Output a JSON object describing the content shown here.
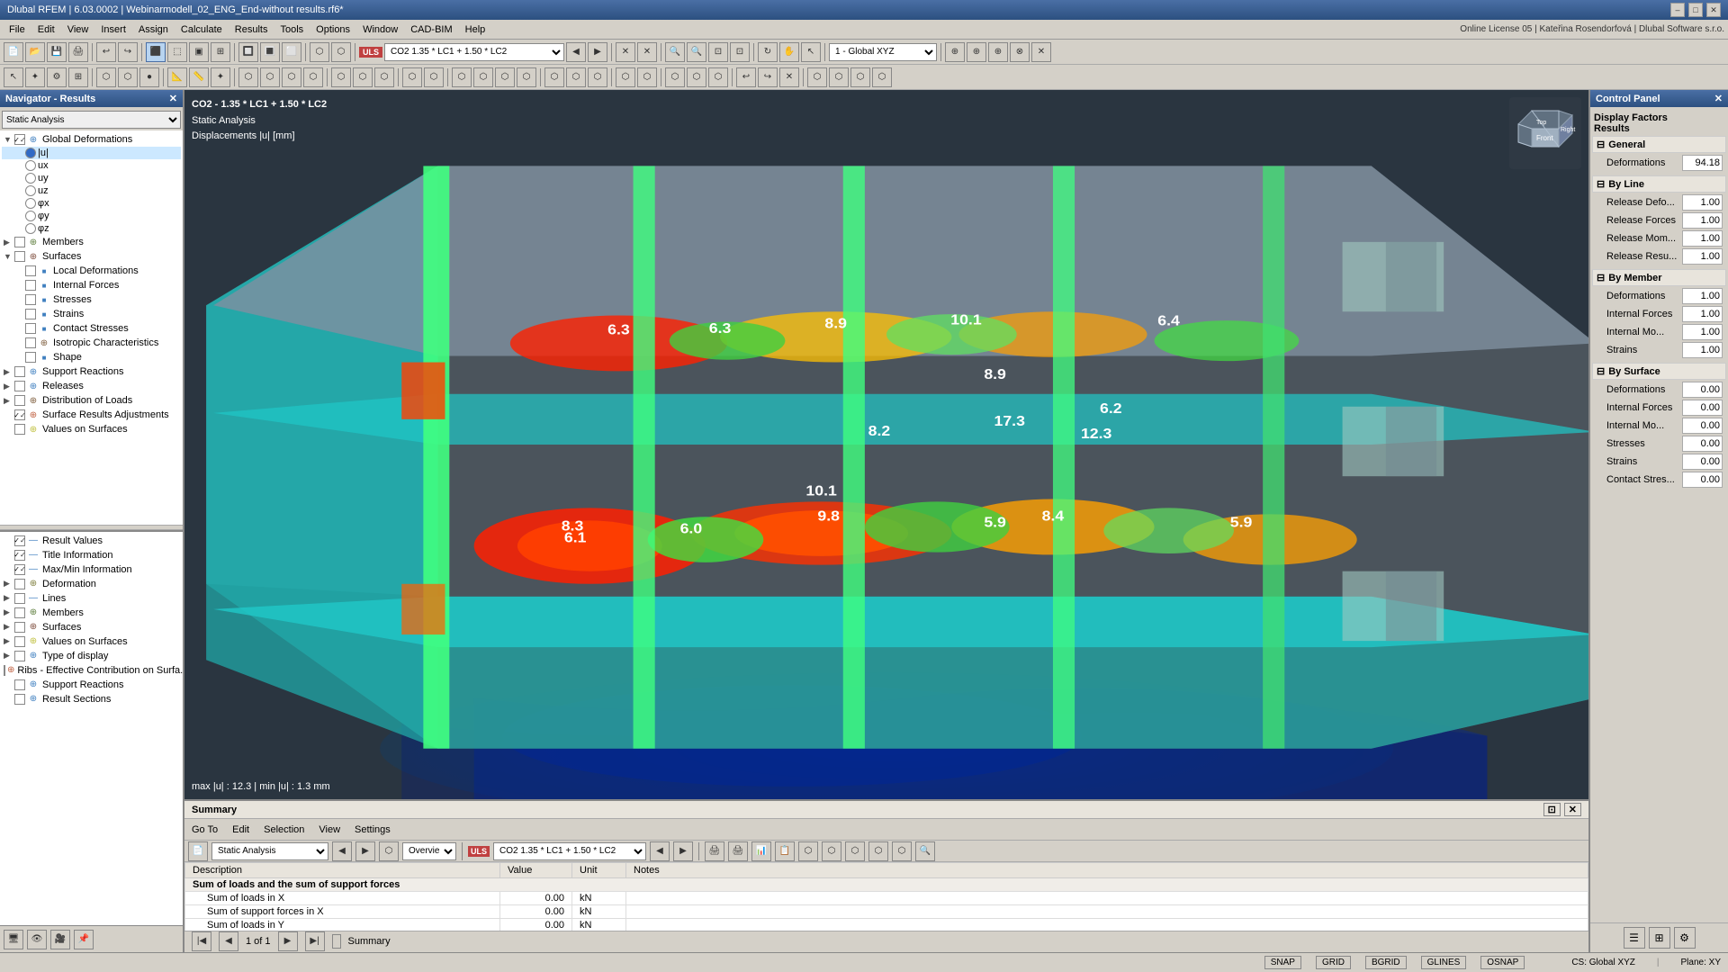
{
  "titlebar": {
    "title": "Dlubal RFEM | 6.03.0002 | Webinarmodell_02_ENG_End-without results.rf6*",
    "controls": [
      "–",
      "□",
      "✕"
    ]
  },
  "menubar": {
    "items": [
      "File",
      "Edit",
      "View",
      "Insert",
      "Assign",
      "Calculate",
      "Results",
      "Tools",
      "Options",
      "Window",
      "CAD-BIM",
      "Help"
    ]
  },
  "toolbar": {
    "uls_label": "ULS",
    "combo_label": "CO2  1.35 * LC1 + 1.50 * LC2",
    "axis_label": "1 - Global XYZ"
  },
  "navigator": {
    "title": "Navigator - Results",
    "combo": "Static Analysis",
    "tree": [
      {
        "level": 0,
        "type": "cb",
        "checked": true,
        "label": "Global Deformations",
        "expand": "▼"
      },
      {
        "level": 1,
        "type": "radio",
        "checked": true,
        "label": "|u|"
      },
      {
        "level": 1,
        "type": "radio",
        "checked": false,
        "label": "ux"
      },
      {
        "level": 1,
        "type": "radio",
        "checked": false,
        "label": "uy"
      },
      {
        "level": 1,
        "type": "radio",
        "checked": false,
        "label": "uz"
      },
      {
        "level": 1,
        "type": "radio",
        "checked": false,
        "label": "φx"
      },
      {
        "level": 1,
        "type": "radio",
        "checked": false,
        "label": "φy"
      },
      {
        "level": 1,
        "type": "radio",
        "checked": false,
        "label": "φz"
      },
      {
        "level": 0,
        "type": "cb",
        "checked": false,
        "label": "Members",
        "expand": "▶"
      },
      {
        "level": 0,
        "type": "cb",
        "checked": false,
        "label": "Surfaces",
        "expand": "▼"
      },
      {
        "level": 1,
        "type": "cb",
        "checked": false,
        "label": "Local Deformations"
      },
      {
        "level": 1,
        "type": "cb",
        "checked": false,
        "label": "Internal Forces"
      },
      {
        "level": 1,
        "type": "cb",
        "checked": false,
        "label": "Stresses"
      },
      {
        "level": 1,
        "type": "cb",
        "checked": false,
        "label": "Strains"
      },
      {
        "level": 1,
        "type": "cb",
        "checked": false,
        "label": "Contact Stresses"
      },
      {
        "level": 1,
        "type": "cb",
        "checked": false,
        "label": "Isotropic Characteristics"
      },
      {
        "level": 1,
        "type": "cb",
        "checked": false,
        "label": "Shape"
      },
      {
        "level": 0,
        "type": "cb",
        "checked": false,
        "label": "Support Reactions",
        "expand": "▶"
      },
      {
        "level": 0,
        "type": "cb",
        "checked": false,
        "label": "Releases",
        "expand": "▶"
      },
      {
        "level": 0,
        "type": "cb",
        "checked": false,
        "label": "Distribution of Loads",
        "expand": "▶"
      },
      {
        "level": 0,
        "type": "cb",
        "checked": true,
        "label": "Surface Results Adjustments"
      },
      {
        "level": 0,
        "type": "cb",
        "checked": false,
        "label": "Values on Surfaces"
      }
    ],
    "bottom_tree": [
      {
        "level": 0,
        "type": "cb",
        "checked": true,
        "label": "Result Values"
      },
      {
        "level": 0,
        "type": "cb",
        "checked": true,
        "label": "Title Information"
      },
      {
        "level": 0,
        "type": "cb",
        "checked": true,
        "label": "Max/Min Information"
      },
      {
        "level": 0,
        "type": "cb",
        "checked": false,
        "label": "Deformation",
        "expand": "▶"
      },
      {
        "level": 0,
        "type": "cb",
        "checked": false,
        "label": "Lines",
        "expand": "▶"
      },
      {
        "level": 0,
        "type": "cb",
        "checked": false,
        "label": "Members",
        "expand": "▶"
      },
      {
        "level": 0,
        "type": "cb",
        "checked": false,
        "label": "Surfaces",
        "expand": "▶"
      },
      {
        "level": 0,
        "type": "cb",
        "checked": false,
        "label": "Values on Surfaces",
        "expand": "▶"
      },
      {
        "level": 0,
        "type": "cb",
        "checked": false,
        "label": "Type of display",
        "expand": "▶"
      },
      {
        "level": 0,
        "type": "cb",
        "checked": false,
        "label": "Ribs - Effective Contribution on Surfa..."
      },
      {
        "level": 0,
        "type": "cb",
        "checked": false,
        "label": "Support Reactions"
      },
      {
        "level": 0,
        "type": "cb",
        "checked": false,
        "label": "Result Sections"
      }
    ]
  },
  "viewport": {
    "info_line1": "CO2 - 1.35 * LC1 + 1.50 * LC2",
    "info_line2": "Static Analysis",
    "info_line3": "Displacements |u| [mm]",
    "maxmin": "max |u| : 12.3 | min |u| : 1.3 mm"
  },
  "summary": {
    "title": "Summary",
    "menu_items": [
      "Go To",
      "Edit",
      "Selection",
      "View",
      "Settings"
    ],
    "combo1": "Static Analysis",
    "combo2": "Overview",
    "uls_label": "ULS",
    "combo3": "CO2  1.35 * LC1 + 1.50 * LC2",
    "table": {
      "headers": [
        "Description",
        "Value",
        "Unit",
        "Notes"
      ],
      "rows": [
        {
          "label": "Sum of loads and the sum of support forces",
          "value": "",
          "unit": "",
          "notes": "",
          "group": true
        },
        {
          "label": "Sum of loads in X",
          "value": "0.00",
          "unit": "kN",
          "notes": ""
        },
        {
          "label": "Sum of support forces in X",
          "value": "0.00",
          "unit": "kN",
          "notes": ""
        },
        {
          "label": "Sum of loads in Y",
          "value": "0.00",
          "unit": "kN",
          "notes": ""
        }
      ]
    },
    "footer": {
      "page_info": "1 of 1",
      "tab_label": "Summary"
    }
  },
  "control_panel": {
    "title": "Control Panel",
    "section_title": "Display Factors Results",
    "general": {
      "label": "General",
      "rows": [
        {
          "label": "Deformations",
          "value": "94.18"
        }
      ]
    },
    "by_line": {
      "label": "By Line",
      "rows": [
        {
          "label": "Release Defo...",
          "value": "1.00"
        },
        {
          "label": "Release Forces",
          "value": "1.00"
        },
        {
          "label": "Release Mom...",
          "value": "1.00"
        },
        {
          "label": "Release Resu...",
          "value": "1.00"
        }
      ]
    },
    "by_member": {
      "label": "By Member",
      "rows": [
        {
          "label": "Deformations",
          "value": "1.00"
        },
        {
          "label": "Internal Forces",
          "value": "1.00"
        },
        {
          "label": "Internal Mo...",
          "value": "1.00"
        },
        {
          "label": "Strains",
          "value": "1.00"
        }
      ]
    },
    "by_surface": {
      "label": "By Surface",
      "rows": [
        {
          "label": "Deformations",
          "value": "0.00"
        },
        {
          "label": "Internal Forces",
          "value": "0.00"
        },
        {
          "label": "Internal Mo...",
          "value": "0.00"
        },
        {
          "label": "Stresses",
          "value": "0.00"
        },
        {
          "label": "Strains",
          "value": "0.00"
        },
        {
          "label": "Contact Stres...",
          "value": "0.00"
        }
      ]
    }
  },
  "statusbar": {
    "items": [
      "SNAP",
      "GRID",
      "BGRID",
      "GLINES",
      "OSNAP"
    ],
    "cs_label": "CS: Global XYZ",
    "plane_label": "Plane: XY"
  },
  "license_info": "Online License 05 | Kateřina Rosendorfová | Dlubal Software s.r.o."
}
